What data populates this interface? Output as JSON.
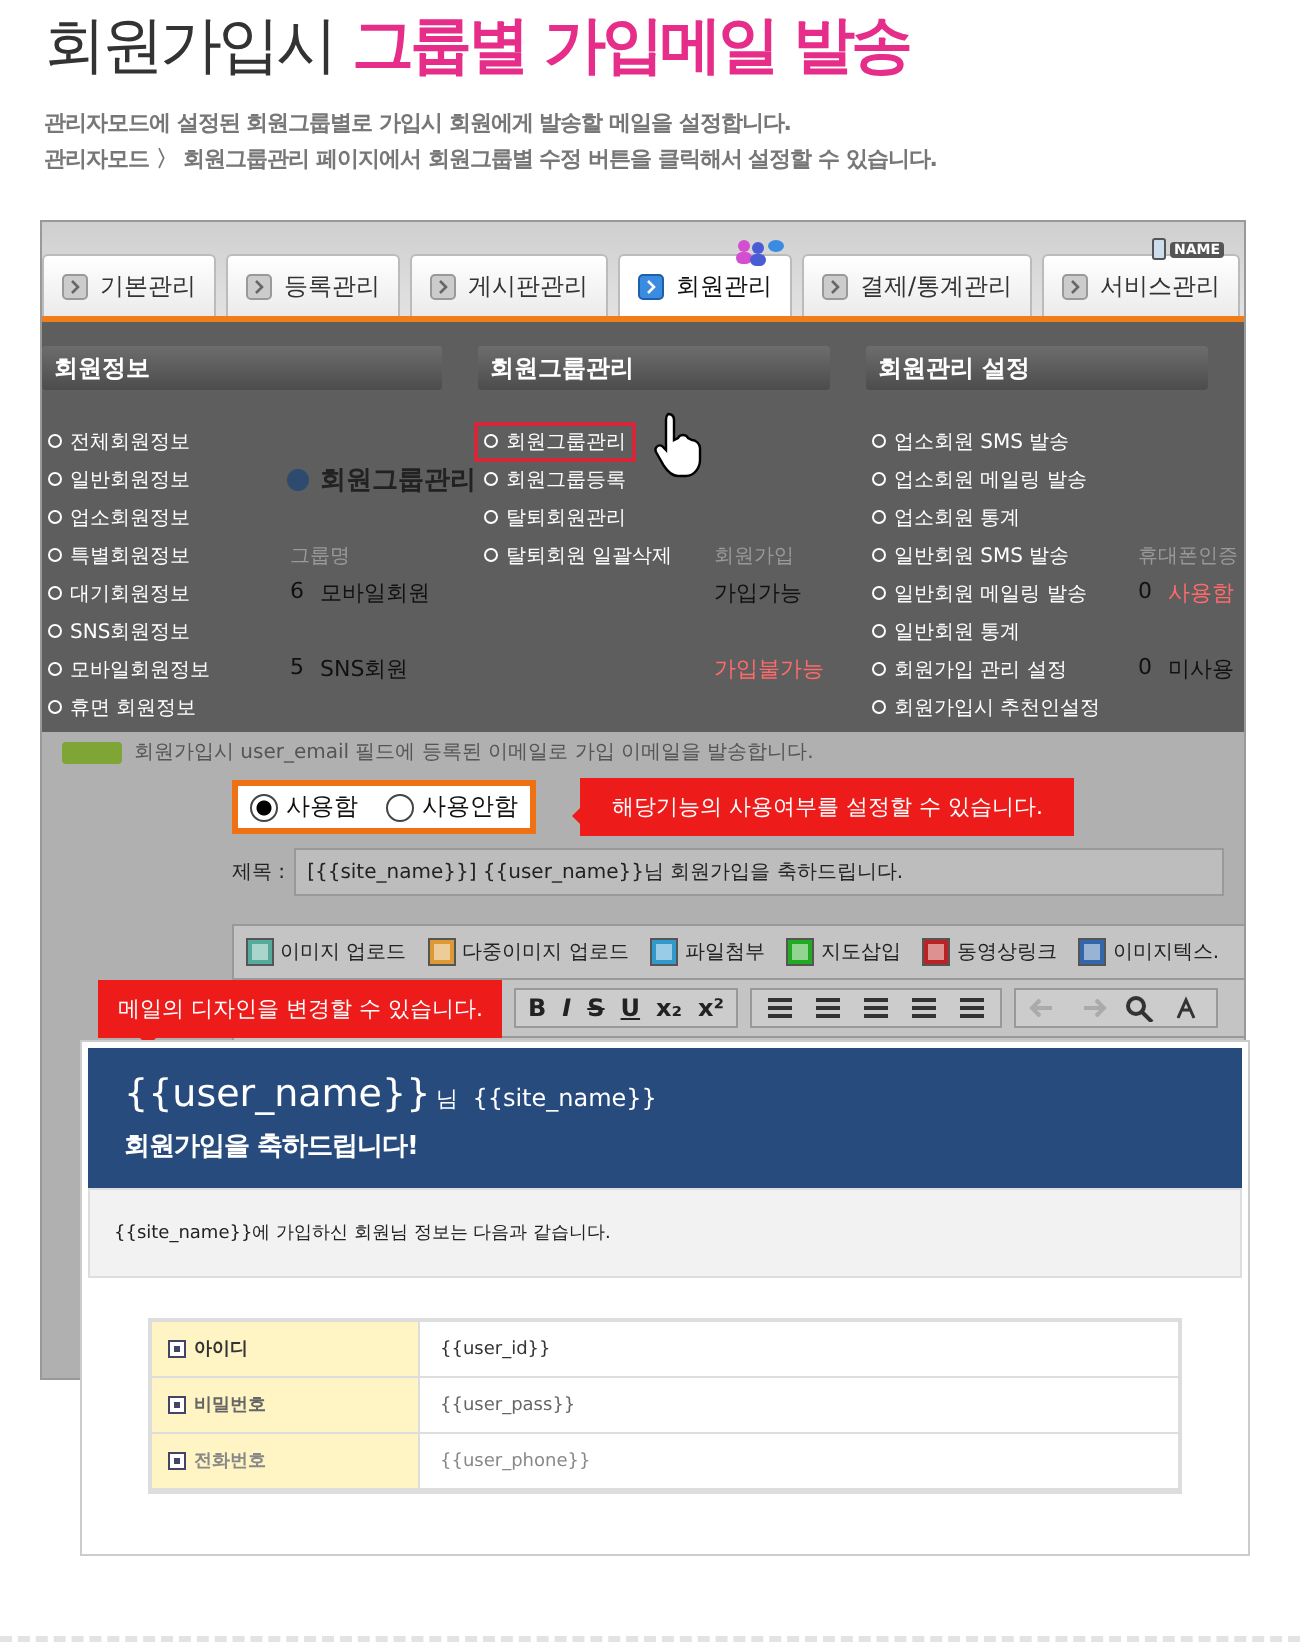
{
  "heading": {
    "plain": "회원가입시",
    "highlight": "그룹별 가입메일 발송"
  },
  "description": [
    "관리자모드에 설정된 회원그룹별로 가입시 회원에게 발송할 메일을 설정합니다.",
    "관리자모드 〉 회원그룹관리 페이지에서 회원그룹별 수정 버튼을 클릭해서 설정할 수 있습니다."
  ],
  "admin": {
    "tabs": [
      {
        "label": "기본관리",
        "selected": false
      },
      {
        "label": "등록관리",
        "selected": false
      },
      {
        "label": "게시판관리",
        "selected": false
      },
      {
        "label": "회원관리",
        "selected": true
      },
      {
        "label": "결제/통계관리",
        "selected": false
      },
      {
        "label": "서비스관리",
        "selected": false
      }
    ],
    "name_badge": "NAME",
    "menu_columns": [
      {
        "heading": "회원정보",
        "items": [
          {
            "label": "전체회원정보",
            "highlighted": false
          },
          {
            "label": "일반회원정보",
            "highlighted": false
          },
          {
            "label": "업소회원정보",
            "highlighted": false
          },
          {
            "label": "특별회원정보",
            "highlighted": false
          },
          {
            "label": "대기회원정보",
            "highlighted": false
          },
          {
            "label": "SNS회원정보",
            "highlighted": false
          },
          {
            "label": "모바일회원정보",
            "highlighted": false
          },
          {
            "label": "휴면 회원정보",
            "highlighted": false
          }
        ]
      },
      {
        "heading": "회원그룹관리",
        "items": [
          {
            "label": "회원그룹관리",
            "highlighted": true
          },
          {
            "label": "회원그룹등록",
            "highlighted": false
          },
          {
            "label": "탈퇴회원관리",
            "highlighted": false
          },
          {
            "label": "탈퇴회원 일괄삭제",
            "highlighted": false
          }
        ]
      },
      {
        "heading": "회원관리 설정",
        "items": [
          {
            "label": "업소회원 SMS 발송",
            "highlighted": false
          },
          {
            "label": "업소회원 메일링 발송",
            "highlighted": false
          },
          {
            "label": "업소회원 통계",
            "highlighted": false
          },
          {
            "label": "일반회원 SMS 발송",
            "highlighted": false
          },
          {
            "label": "일반회원 메일링 발송",
            "highlighted": false
          },
          {
            "label": "일반회원 통계",
            "highlighted": false
          },
          {
            "label": "회원가입 관리 설정",
            "highlighted": false
          },
          {
            "label": "회원가입시 추천인설정",
            "highlighted": false
          }
        ]
      }
    ],
    "page_title": "회원그룹관리",
    "group_table": {
      "columns": [
        "그룹명",
        "회원가입",
        "휴대폰인증"
      ],
      "rows": [
        {
          "no": "6",
          "name": "모바일회원",
          "signup": {
            "text": "가입가능",
            "emphasized": false
          },
          "count": "0",
          "phone_verify": {
            "text": "사용함",
            "emphasized": true
          }
        },
        {
          "no": "5",
          "name": "SNS회원",
          "signup": {
            "text": "가입불가능",
            "emphasized": true
          },
          "count": "0",
          "phone_verify": {
            "text": "미사용",
            "emphasized": false
          }
        }
      ]
    },
    "note": "회원가입시 user_email 필드에 등록된 이메일로 가입 이메일을 발송합니다.",
    "use_options": [
      {
        "label": "사용함",
        "selected": true
      },
      {
        "label": "사용안함",
        "selected": false
      }
    ],
    "use_callout": "해당기능의 사용여부를 설정할 수 있습니다.",
    "subject": {
      "label": "제목 :",
      "value": "[{{site_name}}] {{user_name}}님 회원가입을 축하드립니다."
    },
    "editor_buttons": [
      "이미지 업로드",
      "다중이미지 업로드",
      "파일첨부",
      "지도삽입",
      "동영상링크",
      "이미지텍스."
    ],
    "format_buttons": [
      "B",
      "I",
      "S",
      "U",
      "x₂",
      "x²"
    ],
    "design_callout": "메일의 디자인을 변경할 수 있습니다."
  },
  "email_preview": {
    "user_name": "{{user_name}}",
    "suffix": "님",
    "site_name": "{{site_name}}",
    "greeting": "회원가입을 축하드립니다!",
    "intro": "{{site_name}}에 가입하신 회원님 정보는 다음과 같습니다.",
    "fields": [
      {
        "label": "아이디",
        "value": "{{user_id}}"
      },
      {
        "label": "비밀번호",
        "value": "{{user_pass}}"
      },
      {
        "label": "전화번호",
        "value": "{{user_phone}}"
      }
    ]
  }
}
